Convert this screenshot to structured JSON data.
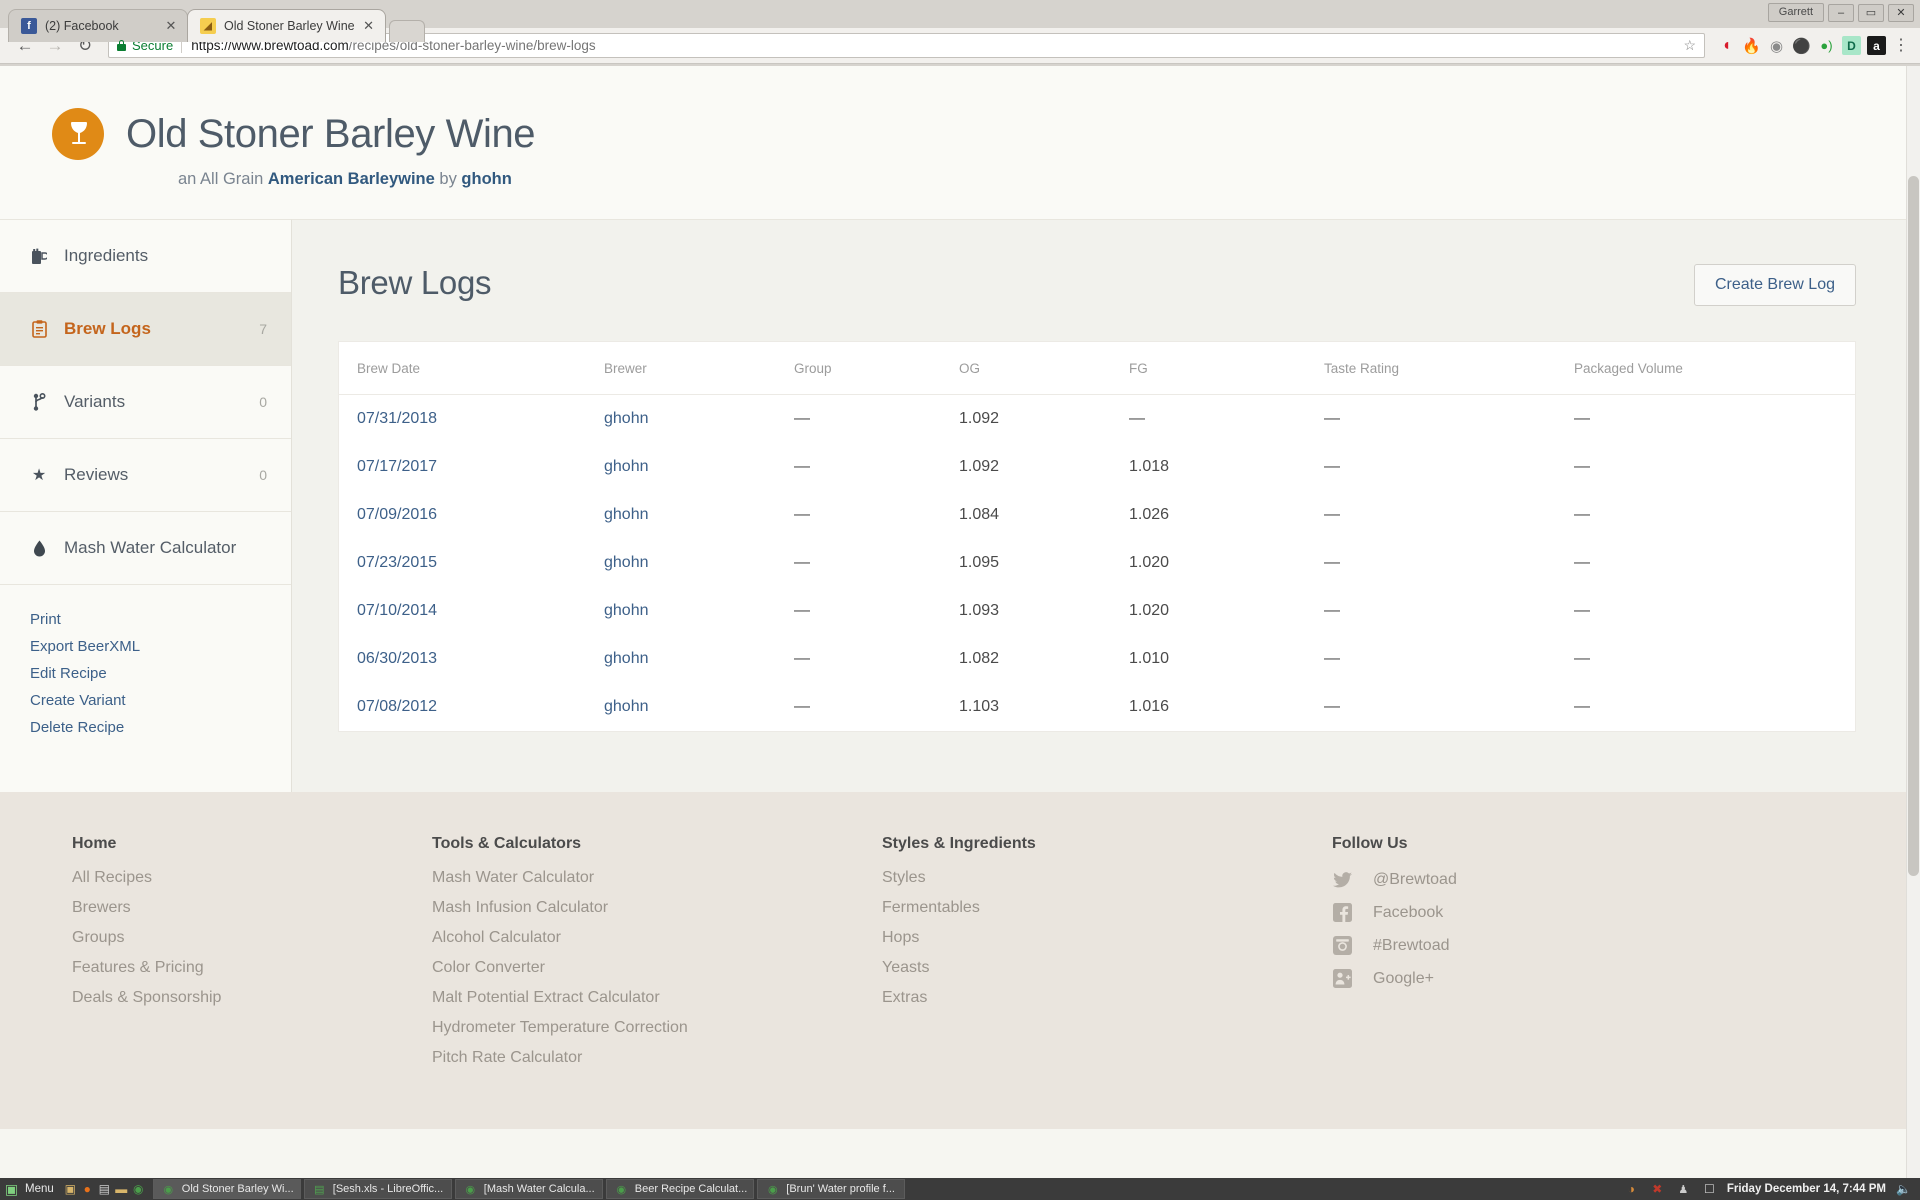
{
  "browser": {
    "tabs": [
      {
        "title": "(2) Facebook",
        "favicon": "facebook-icon",
        "favicon_glyph": "f",
        "active": false
      },
      {
        "title": "Old Stoner Barley Wine",
        "favicon": "brewtoad-icon",
        "favicon_glyph": "◔",
        "active": true
      }
    ],
    "new_tab_label": "",
    "window": {
      "user_label": "Garrett",
      "minimize": "–",
      "maximize": "▭",
      "close": "✕"
    },
    "nav": {
      "back": "←",
      "forward": "→",
      "reload": "↻"
    },
    "address": {
      "security_label": "Secure",
      "url_domain": "https://www.brewtoad.com",
      "url_path": "/recipes/old-stoner-barley-wine/brew-logs",
      "bookmark_star": "☆"
    },
    "extensions": [
      {
        "name": "opera-vpn-icon",
        "glyph": "Ⓞ",
        "color": "#d81c2c",
        "bg": "transparent"
      },
      {
        "name": "flame-icon",
        "glyph": "●",
        "color": "#e8631c",
        "bg": "transparent"
      },
      {
        "name": "film-reel-icon",
        "glyph": "◎",
        "color": "#8a8a8a",
        "bg": "transparent"
      },
      {
        "name": "mask-icon",
        "glyph": "●",
        "color": "#222222",
        "bg": "transparent"
      },
      {
        "name": "signal-icon",
        "glyph": "●",
        "color": "#2aa23c",
        "bg": "transparent"
      },
      {
        "name": "dashlane-icon",
        "glyph": "D",
        "color": "#0f6b4a",
        "bg": "#a8e6c8"
      },
      {
        "name": "amazon-icon",
        "glyph": "a",
        "color": "#ffffff",
        "bg": "#1a1a1a"
      }
    ],
    "menu_icon": "⋮"
  },
  "recipe": {
    "logo_icon": "wine-glass-icon",
    "logo_color": "#e08a16",
    "title": "Old Stoner Barley Wine",
    "subtitle_prefix": "an All Grain ",
    "style": "American Barleywine",
    "subtitle_by": " by ",
    "author": "ghohn"
  },
  "sidebar": {
    "items": [
      {
        "label": "Ingredients",
        "icon": "beer-mug-icon",
        "glyph": "🍺",
        "count": "",
        "active": false
      },
      {
        "label": "Brew Logs",
        "icon": "clipboard-icon",
        "glyph": "📋",
        "count": "7",
        "active": true
      },
      {
        "label": "Variants",
        "icon": "branch-icon",
        "glyph": "⑂",
        "count": "0",
        "active": false
      },
      {
        "label": "Reviews",
        "icon": "star-icon",
        "glyph": "★",
        "count": "0",
        "active": false
      },
      {
        "label": "Mash Water Calculator",
        "icon": "water-drop-icon",
        "glyph": "💧",
        "count": "",
        "active": false
      }
    ],
    "links": [
      {
        "label": "Print",
        "name": "print-link"
      },
      {
        "label": "Export BeerXML",
        "name": "export-beerxml-link"
      },
      {
        "label": "Edit Recipe",
        "name": "edit-recipe-link"
      },
      {
        "label": "Create Variant",
        "name": "create-variant-link"
      },
      {
        "label": "Delete Recipe",
        "name": "delete-recipe-link"
      }
    ]
  },
  "main": {
    "title": "Brew Logs",
    "create_button": "Create Brew Log",
    "table": {
      "columns": [
        "Brew Date",
        "Brewer",
        "Group",
        "OG",
        "FG",
        "Taste Rating",
        "Packaged Volume"
      ],
      "rows": [
        {
          "date": "07/31/2018",
          "brewer": "ghohn",
          "group": "—",
          "og": "1.092",
          "fg": "—",
          "taste": "—",
          "volume": "—"
        },
        {
          "date": "07/17/2017",
          "brewer": "ghohn",
          "group": "—",
          "og": "1.092",
          "fg": "1.018",
          "taste": "—",
          "volume": "—"
        },
        {
          "date": "07/09/2016",
          "brewer": "ghohn",
          "group": "—",
          "og": "1.084",
          "fg": "1.026",
          "taste": "—",
          "volume": "—"
        },
        {
          "date": "07/23/2015",
          "brewer": "ghohn",
          "group": "—",
          "og": "1.095",
          "fg": "1.020",
          "taste": "—",
          "volume": "—"
        },
        {
          "date": "07/10/2014",
          "brewer": "ghohn",
          "group": "—",
          "og": "1.093",
          "fg": "1.020",
          "taste": "—",
          "volume": "—"
        },
        {
          "date": "06/30/2013",
          "brewer": "ghohn",
          "group": "—",
          "og": "1.082",
          "fg": "1.010",
          "taste": "—",
          "volume": "—"
        },
        {
          "date": "07/08/2012",
          "brewer": "ghohn",
          "group": "—",
          "og": "1.103",
          "fg": "1.016",
          "taste": "—",
          "volume": "—"
        }
      ]
    }
  },
  "footer": {
    "columns": [
      {
        "heading": "Home",
        "links": [
          "All Recipes",
          "Brewers",
          "Groups",
          "Features & Pricing",
          "Deals & Sponsorship"
        ]
      },
      {
        "heading": "Tools & Calculators",
        "links": [
          "Mash Water Calculator",
          "Mash Infusion Calculator",
          "Alcohol Calculator",
          "Color Converter",
          "Malt Potential Extract Calculator",
          "Hydrometer Temperature Correction",
          "Pitch Rate Calculator"
        ]
      },
      {
        "heading": "Styles & Ingredients",
        "links": [
          "Styles",
          "Fermentables",
          "Hops",
          "Yeasts",
          "Extras"
        ]
      }
    ],
    "social": {
      "heading": "Follow Us",
      "items": [
        {
          "label": "@Brewtoad",
          "icon": "twitter-icon"
        },
        {
          "label": "Facebook",
          "icon": "facebook-icon"
        },
        {
          "label": "#Brewtoad",
          "icon": "instagram-icon"
        },
        {
          "label": "Google+",
          "icon": "google-plus-icon"
        }
      ]
    }
  },
  "taskbar": {
    "menu_label": "Menu",
    "quick_icons": [
      {
        "name": "files-icon",
        "glyph": "▣",
        "color": "#d8b56a"
      },
      {
        "name": "firefox-icon",
        "glyph": "●",
        "color": "#e8711a"
      },
      {
        "name": "terminal-icon",
        "glyph": "▤",
        "color": "#cccccc"
      },
      {
        "name": "folder-icon",
        "glyph": "▰",
        "color": "#d8b56a"
      },
      {
        "name": "chrome-icon",
        "glyph": "◉",
        "color": "#4a9e4a"
      }
    ],
    "tasks": [
      {
        "label": "Old Stoner Barley Wi...",
        "icon": "chrome-icon",
        "active": true
      },
      {
        "label": "[Sesh.xls - LibreOffic...",
        "icon": "calc-icon",
        "active": false
      },
      {
        "label": "[Mash Water Calcula...",
        "icon": "chrome-icon",
        "active": false
      },
      {
        "label": "Beer Recipe Calculat...",
        "icon": "chrome-icon",
        "active": false
      },
      {
        "label": "[Brun' Water profile f...",
        "icon": "chrome-icon",
        "active": false
      }
    ],
    "tray": [
      {
        "name": "weather-icon",
        "glyph": "◕",
        "color": "#d98c3a"
      },
      {
        "name": "shield-icon",
        "glyph": "✕",
        "color": "#c0392b"
      },
      {
        "name": "user-icon",
        "glyph": "♟",
        "color": "#cccccc"
      },
      {
        "name": "display-icon",
        "glyph": "□",
        "color": "#cccccc"
      }
    ],
    "clock": "Friday December 14,  7:44 PM",
    "volume_icon": "🔊"
  }
}
